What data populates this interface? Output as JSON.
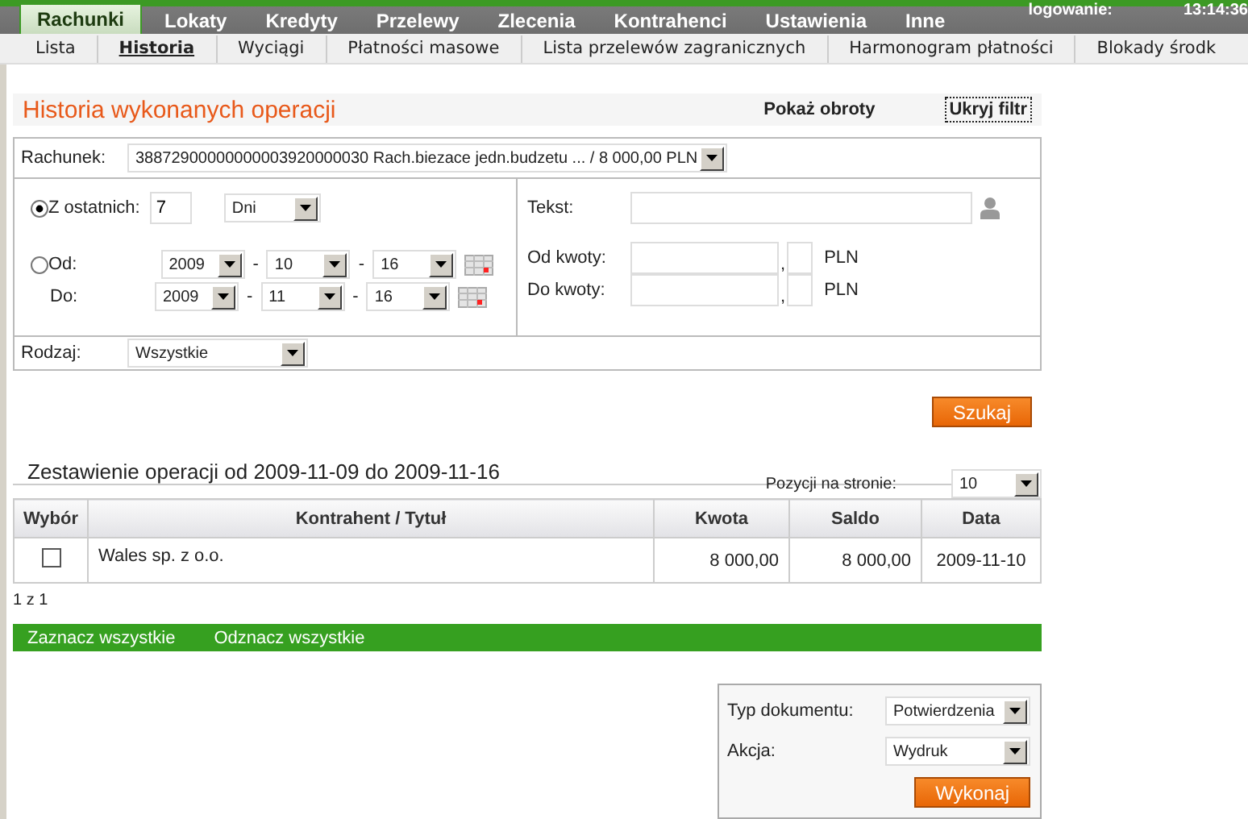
{
  "main_menu": [
    {
      "label": "Rachunki",
      "selected": true
    },
    {
      "label": "Lokaty",
      "selected": false
    },
    {
      "label": "Kredyty",
      "selected": false
    },
    {
      "label": "Przelewy",
      "selected": false
    },
    {
      "label": "Zlecenia",
      "selected": false
    },
    {
      "label": "Kontrahenci",
      "selected": false
    },
    {
      "label": "Ustawienia",
      "selected": false
    },
    {
      "label": "Inne",
      "selected": false
    }
  ],
  "session": {
    "label": "logowanie:",
    "time": "13:14:36"
  },
  "sub_menu": [
    {
      "label": "Lista",
      "selected": false
    },
    {
      "label": "Historia",
      "selected": true
    },
    {
      "label": "Wyciągi",
      "selected": false
    },
    {
      "label": "Płatności masowe",
      "selected": false
    },
    {
      "label": "Lista przelewów zagranicznych",
      "selected": false
    },
    {
      "label": "Harmonogram płatności",
      "selected": false
    },
    {
      "label": "Blokady środk",
      "selected": false
    }
  ],
  "page_title": "Historia wykonanych operacji",
  "actions": [
    {
      "label": "Pokaż obroty",
      "selected": false
    },
    {
      "label": "Ukryj filtr",
      "selected": true
    }
  ],
  "filter": {
    "account": {
      "label": "Rachunek:",
      "value": "38872900000000003920000030 Rach.biezace jedn.budzetu ... / 8 000,00 PLN"
    },
    "modes": [
      {
        "label": "Z ostatnich:",
        "selected": true
      },
      {
        "label": "Od:",
        "selected": false
      }
    ],
    "last": {
      "value": "7",
      "unit": "Dni"
    },
    "separator": "-",
    "from": {
      "year": "2009",
      "month": "10",
      "day": "16"
    },
    "to": {
      "label": "Do:",
      "year": "2009",
      "month": "11",
      "day": "16"
    },
    "text": {
      "label": "Tekst:"
    },
    "amounts": [
      {
        "label": "Od kwoty:",
        "decimal_separator": ",",
        "currency": "PLN"
      },
      {
        "label": "Do kwoty:",
        "decimal_separator": ",",
        "currency": "PLN"
      }
    ],
    "type": {
      "label": "Rodzaj:",
      "value": "Wszystkie"
    }
  },
  "search_button": "Szukaj",
  "results": {
    "title": "Zestawienie operacji od 2009-11-09 do 2009-11-16",
    "per_page": {
      "label": "Pozycji na stronie:",
      "value": "10"
    },
    "columns": [
      "Wybór",
      "Kontrahent / Tytuł",
      "Kwota",
      "Saldo",
      "Data"
    ],
    "rows": [
      {
        "cells": [
          {
            "kind": "checkbox",
            "checked": false
          },
          {
            "kind": "text",
            "text": "Wales sp. z o.o."
          },
          {
            "kind": "text",
            "text": "8 000,00"
          },
          {
            "kind": "text",
            "text": "8 000,00"
          },
          {
            "kind": "text",
            "text": "2009-11-10"
          }
        ]
      }
    ],
    "pager": "1 z 1",
    "bulk_actions": [
      "Zaznacz wszystkie",
      "Odznacz wszystkie"
    ]
  },
  "document": {
    "fields": [
      {
        "label": "Typ dokumentu:",
        "value": "Potwierdzenia"
      },
      {
        "label": "Akcja:",
        "value": "Wydruk"
      }
    ],
    "button": "Wykonaj"
  }
}
